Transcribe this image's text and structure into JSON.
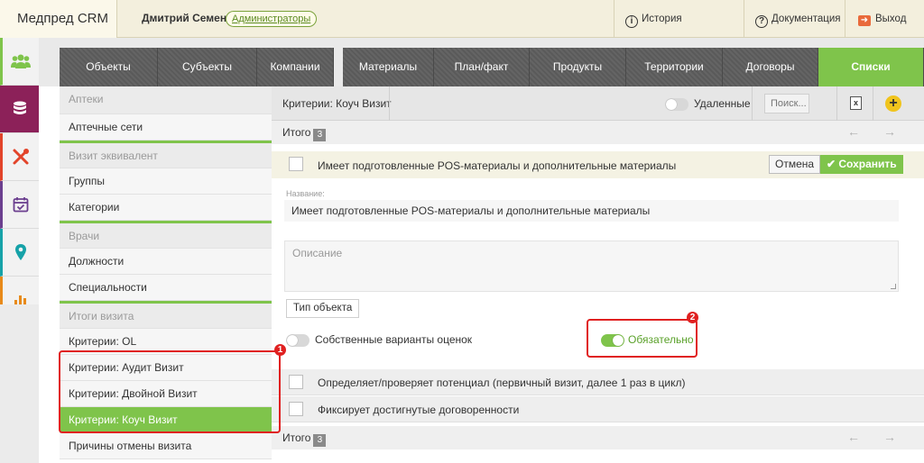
{
  "app": {
    "title": "Медпред CRM"
  },
  "header": {
    "user_name": "Дмитрий Семенов",
    "role": "Администраторы",
    "links": [
      {
        "icon": "info-icon",
        "label": "История обновлений"
      },
      {
        "icon": "help-icon",
        "label": "Документация"
      },
      {
        "icon": "logout-icon",
        "label": "Выход"
      }
    ]
  },
  "rail": {
    "items": [
      {
        "icon": "users-icon",
        "color": "#7fc44b"
      },
      {
        "icon": "database-icon",
        "color": "#8c2159"
      },
      {
        "icon": "tools-icon",
        "color": "#e2442a"
      },
      {
        "icon": "calendar-icon",
        "color": "#6b3f8f"
      },
      {
        "icon": "map-pin-icon",
        "color": "#16a2a8"
      },
      {
        "icon": "bar-chart-icon",
        "color": "#e88a1a"
      }
    ]
  },
  "nav": {
    "tabs": [
      {
        "label": "Объекты"
      },
      {
        "label": "Субъекты"
      },
      {
        "label": "Компании"
      },
      {
        "label": "Материалы"
      },
      {
        "label": "План/факт"
      },
      {
        "label": "Продукты"
      },
      {
        "label": "Территории"
      },
      {
        "label": "Договоры"
      },
      {
        "label": "Списки",
        "active": true
      }
    ]
  },
  "sidebar": {
    "items": [
      {
        "label": "Аптеки",
        "type": "header"
      },
      {
        "label": "Аптечные сети"
      },
      {
        "label": "Визит эквивалент",
        "type": "header"
      },
      {
        "label": "Группы"
      },
      {
        "label": "Категории"
      },
      {
        "label": "Врачи",
        "type": "header"
      },
      {
        "label": "Должности"
      },
      {
        "label": "Специальности"
      },
      {
        "label": "Итоги визита",
        "type": "header"
      },
      {
        "label": "Критерии: OL"
      },
      {
        "label": "Критерии: Аудит Визит"
      },
      {
        "label": "Критерии: Двойной Визит"
      },
      {
        "label": "Критерии: Коуч Визит",
        "active": true
      },
      {
        "label": "Причины отмены визита"
      }
    ]
  },
  "content": {
    "title": "Критерии: Коуч Визит",
    "deleted_toggle_label": "Удаленные",
    "search_placeholder": "Поиск...",
    "total_label": "Итого",
    "total_count": "3",
    "editing": {
      "title": "Имеет подготовленные POS-материалы и дополнительные материалы",
      "cancel_label": "Отмена",
      "save_label": "Сохранить",
      "name_field_label": "Название:",
      "name_value": "Имеет подготовленные POS-материалы и дополнительные материалы",
      "description_placeholder": "Описание",
      "object_type_label": "Тип объекта",
      "own_ratings_label": "Собственные варианты оценок",
      "own_ratings_enabled": false,
      "required_label": "Обязательно",
      "required_enabled": true
    },
    "rows": [
      {
        "label": "Определяет/проверяет потенциал (первичный визит, далее 1 раз в цикл)"
      },
      {
        "label": "Фиксирует достигнутые договоренности"
      }
    ]
  },
  "annotations": [
    {
      "label": "1"
    },
    {
      "label": "2"
    }
  ]
}
